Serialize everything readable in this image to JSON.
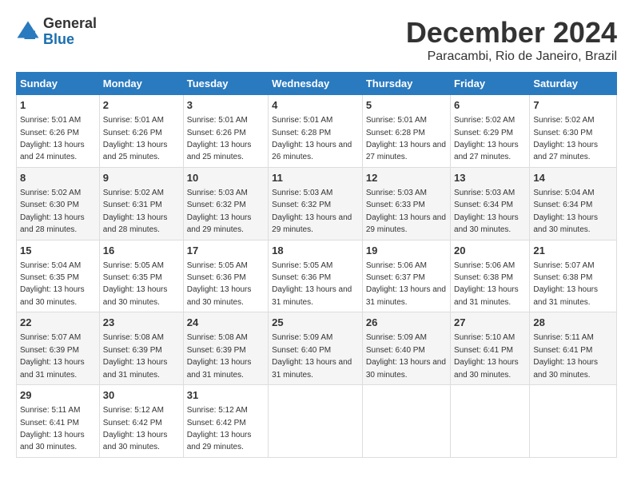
{
  "header": {
    "logo_general": "General",
    "logo_blue": "Blue",
    "title": "December 2024",
    "subtitle": "Paracambi, Rio de Janeiro, Brazil"
  },
  "calendar": {
    "days_of_week": [
      "Sunday",
      "Monday",
      "Tuesday",
      "Wednesday",
      "Thursday",
      "Friday",
      "Saturday"
    ],
    "weeks": [
      [
        {
          "day": "1",
          "sunrise": "5:01 AM",
          "sunset": "6:26 PM",
          "daylight": "13 hours and 24 minutes."
        },
        {
          "day": "2",
          "sunrise": "5:01 AM",
          "sunset": "6:26 PM",
          "daylight": "13 hours and 25 minutes."
        },
        {
          "day": "3",
          "sunrise": "5:01 AM",
          "sunset": "6:26 PM",
          "daylight": "13 hours and 25 minutes."
        },
        {
          "day": "4",
          "sunrise": "5:01 AM",
          "sunset": "6:28 PM",
          "daylight": "13 hours and 26 minutes."
        },
        {
          "day": "5",
          "sunrise": "5:01 AM",
          "sunset": "6:28 PM",
          "daylight": "13 hours and 27 minutes."
        },
        {
          "day": "6",
          "sunrise": "5:02 AM",
          "sunset": "6:29 PM",
          "daylight": "13 hours and 27 minutes."
        },
        {
          "day": "7",
          "sunrise": "5:02 AM",
          "sunset": "6:30 PM",
          "daylight": "13 hours and 27 minutes."
        }
      ],
      [
        {
          "day": "8",
          "sunrise": "5:02 AM",
          "sunset": "6:30 PM",
          "daylight": "13 hours and 28 minutes."
        },
        {
          "day": "9",
          "sunrise": "5:02 AM",
          "sunset": "6:31 PM",
          "daylight": "13 hours and 28 minutes."
        },
        {
          "day": "10",
          "sunrise": "5:03 AM",
          "sunset": "6:32 PM",
          "daylight": "13 hours and 29 minutes."
        },
        {
          "day": "11",
          "sunrise": "5:03 AM",
          "sunset": "6:32 PM",
          "daylight": "13 hours and 29 minutes."
        },
        {
          "day": "12",
          "sunrise": "5:03 AM",
          "sunset": "6:33 PM",
          "daylight": "13 hours and 29 minutes."
        },
        {
          "day": "13",
          "sunrise": "5:03 AM",
          "sunset": "6:34 PM",
          "daylight": "13 hours and 30 minutes."
        },
        {
          "day": "14",
          "sunrise": "5:04 AM",
          "sunset": "6:34 PM",
          "daylight": "13 hours and 30 minutes."
        }
      ],
      [
        {
          "day": "15",
          "sunrise": "5:04 AM",
          "sunset": "6:35 PM",
          "daylight": "13 hours and 30 minutes."
        },
        {
          "day": "16",
          "sunrise": "5:05 AM",
          "sunset": "6:35 PM",
          "daylight": "13 hours and 30 minutes."
        },
        {
          "day": "17",
          "sunrise": "5:05 AM",
          "sunset": "6:36 PM",
          "daylight": "13 hours and 30 minutes."
        },
        {
          "day": "18",
          "sunrise": "5:05 AM",
          "sunset": "6:36 PM",
          "daylight": "13 hours and 31 minutes."
        },
        {
          "day": "19",
          "sunrise": "5:06 AM",
          "sunset": "6:37 PM",
          "daylight": "13 hours and 31 minutes."
        },
        {
          "day": "20",
          "sunrise": "5:06 AM",
          "sunset": "6:38 PM",
          "daylight": "13 hours and 31 minutes."
        },
        {
          "day": "21",
          "sunrise": "5:07 AM",
          "sunset": "6:38 PM",
          "daylight": "13 hours and 31 minutes."
        }
      ],
      [
        {
          "day": "22",
          "sunrise": "5:07 AM",
          "sunset": "6:39 PM",
          "daylight": "13 hours and 31 minutes."
        },
        {
          "day": "23",
          "sunrise": "5:08 AM",
          "sunset": "6:39 PM",
          "daylight": "13 hours and 31 minutes."
        },
        {
          "day": "24",
          "sunrise": "5:08 AM",
          "sunset": "6:39 PM",
          "daylight": "13 hours and 31 minutes."
        },
        {
          "day": "25",
          "sunrise": "5:09 AM",
          "sunset": "6:40 PM",
          "daylight": "13 hours and 31 minutes."
        },
        {
          "day": "26",
          "sunrise": "5:09 AM",
          "sunset": "6:40 PM",
          "daylight": "13 hours and 30 minutes."
        },
        {
          "day": "27",
          "sunrise": "5:10 AM",
          "sunset": "6:41 PM",
          "daylight": "13 hours and 30 minutes."
        },
        {
          "day": "28",
          "sunrise": "5:11 AM",
          "sunset": "6:41 PM",
          "daylight": "13 hours and 30 minutes."
        }
      ],
      [
        {
          "day": "29",
          "sunrise": "5:11 AM",
          "sunset": "6:41 PM",
          "daylight": "13 hours and 30 minutes."
        },
        {
          "day": "30",
          "sunrise": "5:12 AM",
          "sunset": "6:42 PM",
          "daylight": "13 hours and 30 minutes."
        },
        {
          "day": "31",
          "sunrise": "5:12 AM",
          "sunset": "6:42 PM",
          "daylight": "13 hours and 29 minutes."
        },
        null,
        null,
        null,
        null
      ]
    ]
  }
}
